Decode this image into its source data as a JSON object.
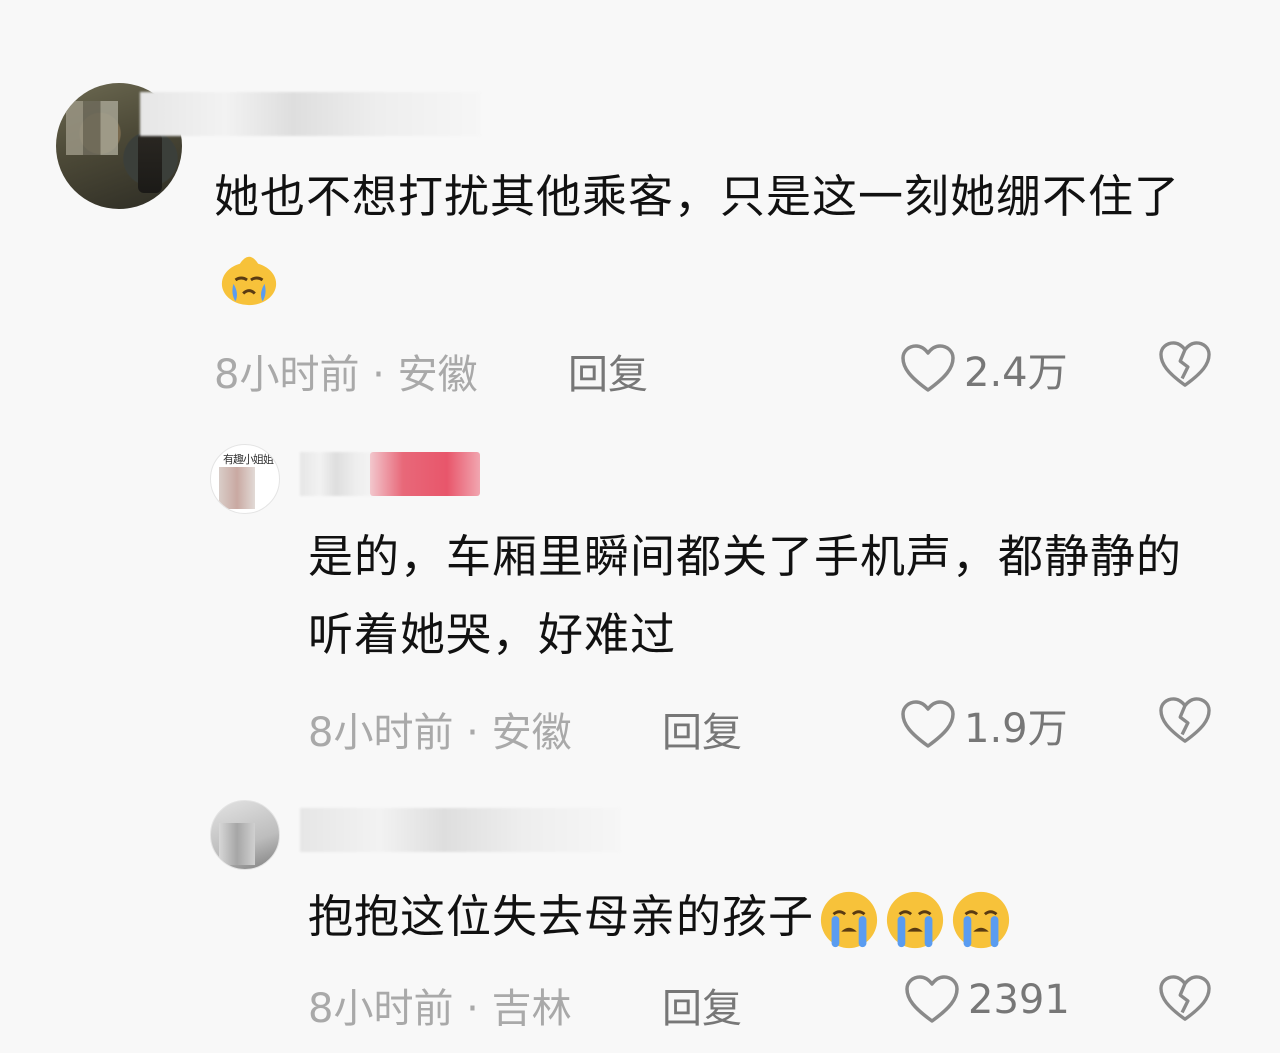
{
  "comments": [
    {
      "text": "她也不想打扰其他乘客，只是这一刻她绷不住了",
      "emoji": "crying-face",
      "time": "8小时前",
      "location": "安徽",
      "reply_label": "回复",
      "likes": "2.4万"
    },
    {
      "text": "是的，车厢里瞬间都关了手机声，都静静的听着她哭，好难过",
      "time": "8小时前",
      "location": "安徽",
      "reply_label": "回复",
      "likes": "1.9万"
    },
    {
      "text": "抱抱这位失去母亲的孩子",
      "emoji": "loudly-crying-face x3",
      "time": "8小时前",
      "location": "吉林",
      "reply_label": "回复",
      "likes": "2391"
    }
  ],
  "separator": "·",
  "colors": {
    "background": "#f8f8f8",
    "text": "#111111",
    "meta": "#a9a9a9",
    "emoji_yellow": "#f7c23a",
    "tears_blue": "#5a9cf0"
  },
  "icons": {
    "like": "heart-outline-icon",
    "dislike": "broken-heart-icon"
  }
}
